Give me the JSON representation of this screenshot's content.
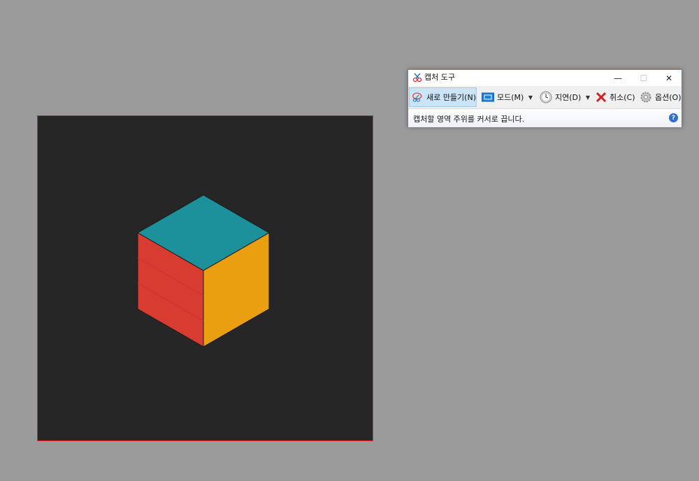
{
  "window": {
    "title": "캡처 도구",
    "minimize_glyph": "—",
    "maximize_glyph": "☐",
    "close_glyph": "✕"
  },
  "toolbar": {
    "new_label": "새로 만들기(N)",
    "mode_label": "모드(M)",
    "delay_label": "지연(D)",
    "cancel_label": "취소(C)",
    "options_label": "옵션(O)",
    "dropdown_glyph": "▼"
  },
  "status": {
    "message": "캡처할 영역 주위를 커서로 끕니다.",
    "help_glyph": "?"
  },
  "colors": {
    "desktop": "#9b9b9b",
    "region_bg": "#262626",
    "region_border": "#e0262b",
    "cube_top": "#1d919b",
    "cube_left": "#d83c31",
    "cube_right": "#e99f10",
    "window_border": "#3c8ee0"
  },
  "icons": {
    "title": "scissors-icon",
    "new": "scissors-icon",
    "mode": "rectangle-snip-icon",
    "delay": "clock-icon",
    "cancel": "red-x-icon",
    "options": "gear-icon",
    "help": "help-icon"
  }
}
